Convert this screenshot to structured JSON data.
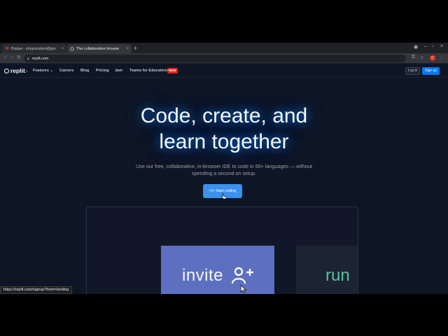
{
  "browser": {
    "tabs": [
      {
        "title": "Bxjqwi - shppstudent@gm",
        "favicon": "gmail-icon"
      },
      {
        "title": "The collaborative browse",
        "favicon": "replit-favicon"
      }
    ],
    "new_tab": "+",
    "url": "replit.com",
    "profile_initial": "C",
    "status_url": "https://replit.com/signup?from=landing"
  },
  "site": {
    "logo_text": "replit",
    "nav": {
      "features": "Features",
      "careers": "Careers",
      "blog": "Blog",
      "pricing": "Pricing",
      "jam": "Jam",
      "teams": "Teams for Education",
      "new_badge": "NEW"
    },
    "login": "Log in",
    "signup": "Sign up"
  },
  "hero": {
    "title_line1": "Code, create, and",
    "title_line2": "learn together",
    "subtitle_line1": "Use our free, collaborative, in-browser IDE to code in 50+ languages — without",
    "subtitle_line2": "spending a second on setup.",
    "cta": "Start coding",
    "cta_icon": "code-icon"
  },
  "showcase": {
    "invite_word": "invite",
    "run_word": "run"
  },
  "colors": {
    "page_bg": "#0e1525",
    "accent_blue": "#0079f2",
    "cta_blue": "#3b91ed",
    "invite_card": "#5d6fbf",
    "run_green": "#59c59a",
    "new_badge": "#e52222"
  }
}
